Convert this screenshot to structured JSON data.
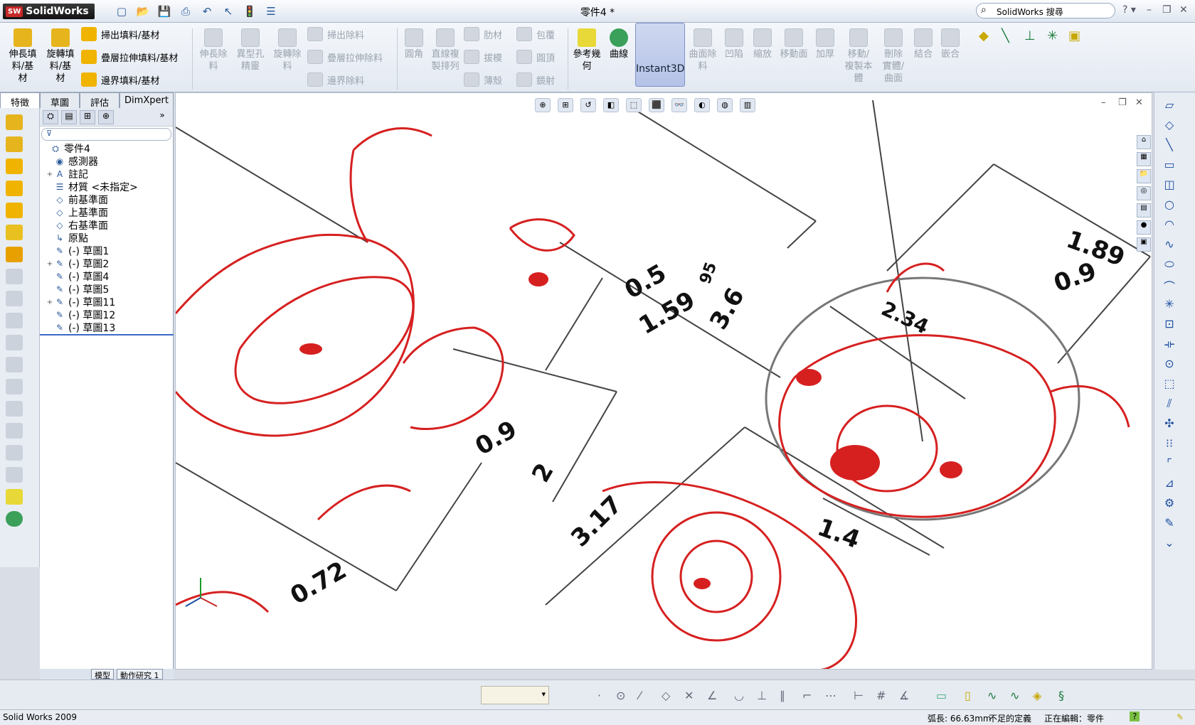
{
  "app": {
    "logo_text": "SolidWorks",
    "logo_badge": "SW"
  },
  "window": {
    "title": "零件4 *"
  },
  "search": {
    "placeholder": "SolidWorks 搜尋"
  },
  "ribbon": {
    "big": [
      {
        "label": "伸長填\n料/基\n材",
        "color": "#e6b41d"
      },
      {
        "label": "旋轉填\n料/基\n材",
        "color": "#e6b41d"
      }
    ],
    "small_col1": [
      "掃出填料/基材",
      "疊層拉伸填料/基材",
      "邊界填料/基材"
    ],
    "disabled_big": [
      "伸長除\n料",
      "異型孔\n精靈",
      "旋轉除\n料"
    ],
    "disabled_col2": [
      "掃出除料",
      "疊層拉伸除料",
      "邊界除料"
    ],
    "disabled_col3": [
      "圓角",
      "直線複\n製排列"
    ],
    "disabled_col4": [
      "肋材",
      "拔模",
      "薄殼"
    ],
    "disabled_col5": [
      "包覆",
      "圓頂",
      "鏡射"
    ],
    "ref_geom": "參考幾\n何",
    "curves": "曲線",
    "instant3d": "Instant3D",
    "disabled_right": [
      "曲面除\n料",
      "凹陷",
      "縮放",
      "移動面",
      "加厚",
      "移動/\n複製本\n體",
      "刪除\n實體/\n曲面",
      "結合",
      "嵌合"
    ]
  },
  "tabs": [
    "特徵",
    "草圖",
    "評估",
    "DimXpert"
  ],
  "tree": {
    "filter_icon": "filter-icon",
    "items": [
      {
        "label": "零件4",
        "icon": "part",
        "expand": ""
      },
      {
        "label": "感測器",
        "icon": "sensor",
        "expand": ""
      },
      {
        "label": "註記",
        "icon": "annotation",
        "expand": "+"
      },
      {
        "label": "材質 <未指定>",
        "icon": "material",
        "expand": ""
      },
      {
        "label": "前基準面",
        "icon": "plane",
        "expand": ""
      },
      {
        "label": "上基準面",
        "icon": "plane",
        "expand": ""
      },
      {
        "label": "右基準面",
        "icon": "plane",
        "expand": ""
      },
      {
        "label": "原點",
        "icon": "origin",
        "expand": ""
      },
      {
        "label": "(-) 草圖1",
        "icon": "sketch",
        "expand": ""
      },
      {
        "label": "(-) 草圖2",
        "icon": "sketch",
        "expand": "+"
      },
      {
        "label": "(-) 草圖4",
        "icon": "sketch",
        "expand": ""
      },
      {
        "label": "(-) 草圖5",
        "icon": "sketch",
        "expand": ""
      },
      {
        "label": "(-) 草圖11",
        "icon": "sketch",
        "expand": "+"
      },
      {
        "label": "(-) 草圖12",
        "icon": "sketch",
        "expand": ""
      },
      {
        "label": "(-) 草圖13",
        "icon": "sketch",
        "expand": ""
      }
    ]
  },
  "bottom_tabs": [
    "模型",
    "動作研究 1"
  ],
  "dimensions": [
    "0.5",
    "1.59",
    "3.6",
    "95",
    "1.89",
    "0.9",
    "2.34",
    "0.9",
    "2",
    "3.17",
    "1.4",
    "0.72"
  ],
  "status": {
    "app": "Solid Works 2009",
    "arc_length": "弧長: 66.63mm",
    "definition": "不足的定義",
    "editing": "正在編輯：零件",
    "help": "?"
  },
  "colors": {
    "accent": "#3a6bc8",
    "sketch_red": "#d62020",
    "instant3d_bg": "#b4c2e8"
  }
}
